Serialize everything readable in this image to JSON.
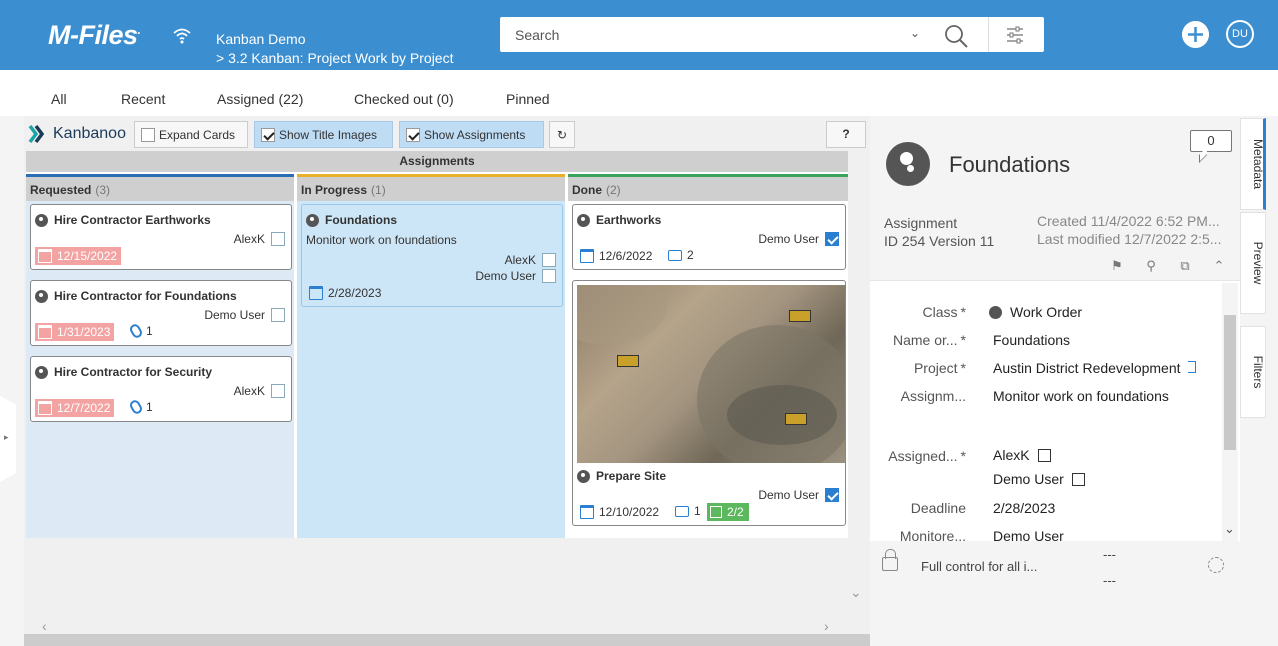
{
  "app": {
    "logo": "M-Files",
    "vault_name": "Kanban Demo",
    "view_path": "> 3.2 Kanban: Project Work by Project",
    "search_placeholder": "Search",
    "user_initials": "DU"
  },
  "tabs": [
    "All",
    "Recent",
    "Assigned (22)",
    "Checked out (0)",
    "Pinned"
  ],
  "kanban": {
    "brand": "Kanbanoo",
    "toolbar": {
      "expand_cards": "Expand Cards",
      "show_title_images": "Show Title Images",
      "show_assignments": "Show Assignments",
      "help": "?"
    },
    "group_title": "Assignments",
    "columns": [
      {
        "name": "Requested",
        "count": "(3)",
        "accent": "#2a6db5"
      },
      {
        "name": "In Progress",
        "count": "(1)",
        "accent": "#e8b12c"
      },
      {
        "name": "Done",
        "count": "(2)",
        "accent": "#3aa35c"
      }
    ],
    "cards": {
      "c1": {
        "title": "Hire Contractor Earthworks",
        "assignee": "AlexK",
        "date": "12/15/2022"
      },
      "c2": {
        "title": "Hire Contractor for Foundations",
        "assignee": "Demo User",
        "date": "1/31/2023",
        "attachments": "1"
      },
      "c3": {
        "title": "Hire Contractor for Security",
        "assignee": "AlexK",
        "date": "12/7/2022",
        "attachments": "1"
      },
      "c4": {
        "title": "Foundations",
        "description": "Monitor work on foundations",
        "assignee1": "AlexK",
        "assignee2": "Demo User",
        "date": "2/28/2023"
      },
      "c5": {
        "title": "Earthworks",
        "assignee": "Demo User",
        "date": "12/6/2022",
        "comments": "2"
      },
      "c6": {
        "title": "Prepare Site",
        "assignee": "Demo User",
        "date": "12/10/2022",
        "comments": "1",
        "tasks": "2/2"
      }
    }
  },
  "metadata": {
    "title": "Foundations",
    "comment_count": "0",
    "object_type": "Assignment",
    "id_version": "ID 254  Version 11",
    "created": "Created 11/4/2022 6:52 PM...",
    "modified": "Last modified 12/7/2022 2:5...",
    "properties": [
      {
        "label": "Class",
        "value": "Work Order"
      },
      {
        "label": "Name or...",
        "value": "Foundations"
      },
      {
        "label": "Project",
        "value": "Austin District Redevelopment"
      },
      {
        "label": "Assignm...",
        "value": "Monitor work on foundations"
      },
      {
        "label": "Assigned...",
        "value": "AlexK"
      },
      {
        "label": "",
        "value": "Demo User"
      },
      {
        "label": "Deadline",
        "value": "2/28/2023"
      },
      {
        "label": "Monitore...",
        "value": "Demo User"
      }
    ],
    "permissions": "Full control for all i...",
    "dash_top": "---",
    "dash_bottom": "---"
  },
  "side_tabs": [
    "Metadata",
    "Preview",
    "Filters"
  ],
  "colors": {
    "brand_bar": "#3b8fd0",
    "selected_card": "#cde6f7",
    "overdue": "#f4a3a3",
    "task_badge": "#5cb85c"
  }
}
